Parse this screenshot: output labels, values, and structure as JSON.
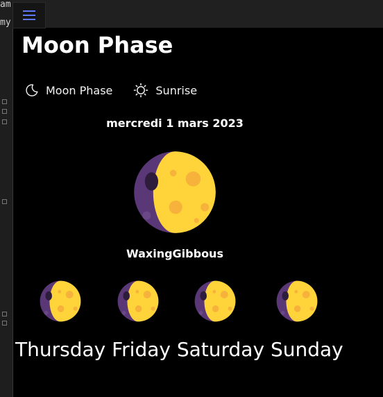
{
  "background": {
    "frag_a": "am",
    "frag_b": "my"
  },
  "app": {
    "title": "Moon Phase"
  },
  "tabs": [
    {
      "label": "Moon Phase",
      "icon": "crescent-moon-icon"
    },
    {
      "label": "Sunrise",
      "icon": "sun-icon"
    }
  ],
  "current": {
    "date": "mercredi 1 mars 2023",
    "phase": "WaxingGibbous"
  },
  "forecast": {
    "days_text": "Thursday Friday Saturday Sunday",
    "days": [
      "Thursday",
      "Friday",
      "Saturday",
      "Sunday"
    ]
  },
  "colors": {
    "moon": "#ffd43b",
    "shadow": "#5a3776",
    "crater": "#f6b23a",
    "accent": "#5f79ff"
  }
}
